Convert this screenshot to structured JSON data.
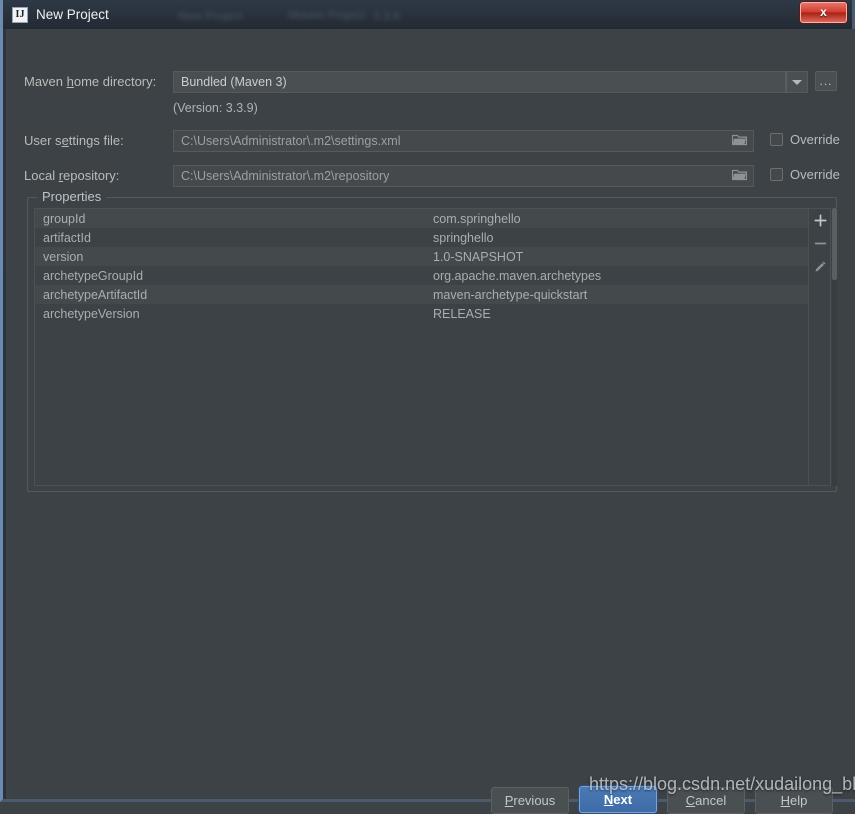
{
  "window": {
    "title": "New Project",
    "logo_text": "IJ",
    "close_label": "x",
    "ghost_text_a": "New Project",
    "ghost_text_b": "Maven Project",
    "ghost_text_c": "3.3.9"
  },
  "form": {
    "maven_home": {
      "label_pre": "Maven ",
      "label_mnemonic": "h",
      "label_post": "ome directory:",
      "value": "Bundled (Maven 3)",
      "browse_label": "...",
      "version_note": "(Version: 3.3.9)"
    },
    "user_settings": {
      "label_pre": "User s",
      "label_mnemonic": "e",
      "label_post": "ttings file:",
      "value": "C:\\Users\\Administrator\\.m2\\settings.xml",
      "override_label": "Override",
      "override_checked": false
    },
    "local_repository": {
      "label_pre": "Local ",
      "label_mnemonic": "r",
      "label_post": "epository:",
      "value": "C:\\Users\\Administrator\\.m2\\repository",
      "override_label": "Override",
      "override_checked": false
    }
  },
  "properties": {
    "legend": "Properties",
    "rows": [
      {
        "key": "groupId",
        "value": "com.springhello"
      },
      {
        "key": "artifactId",
        "value": "springhello"
      },
      {
        "key": "version",
        "value": "1.0-SNAPSHOT"
      },
      {
        "key": "archetypeGroupId",
        "value": "org.apache.maven.archetypes"
      },
      {
        "key": "archetypeArtifactId",
        "value": "maven-archetype-quickstart"
      },
      {
        "key": "archetypeVersion",
        "value": "RELEASE"
      }
    ],
    "toolbar": {
      "add_label": "+",
      "remove_label": "-",
      "edit_label": "edit"
    }
  },
  "footer": {
    "previous": {
      "pre": "",
      "mnemonic": "P",
      "post": "revious"
    },
    "next": {
      "pre": "",
      "mnemonic": "N",
      "post": "ext"
    },
    "cancel": {
      "pre": "",
      "mnemonic": "C",
      "post": "ancel"
    },
    "help": {
      "pre": "",
      "mnemonic": "H",
      "post": "elp"
    }
  },
  "watermark": "https://blog.csdn.net/xudailong_blog",
  "colors": {
    "dialog_bg": "#3c4245",
    "field_bg": "#45494c",
    "accent_default_button": "#4a79b5",
    "close_button": "#d23b2c",
    "text": "#bbbbbb"
  }
}
